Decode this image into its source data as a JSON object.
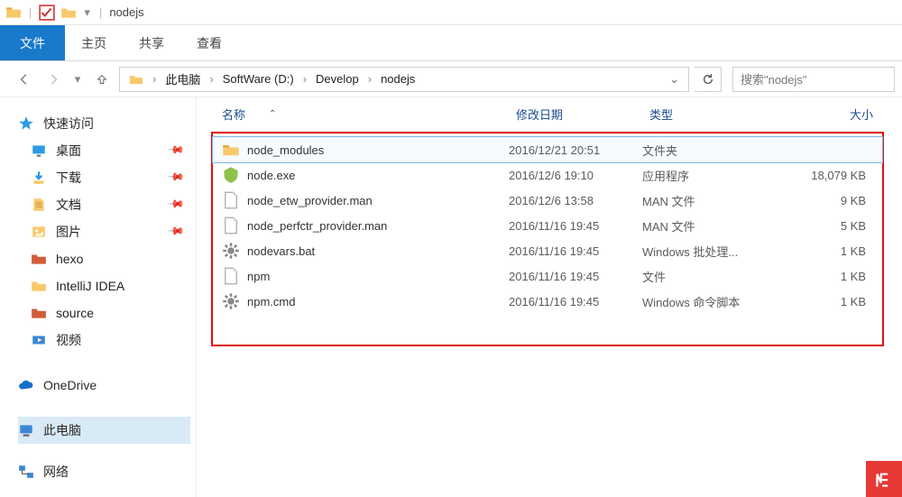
{
  "titlebar": {
    "appname": "nodejs"
  },
  "ribbon": {
    "file": "文件",
    "tabs": [
      "主页",
      "共享",
      "查看"
    ]
  },
  "breadcrumbs": [
    "此电脑",
    "SoftWare (D:)",
    "Develop",
    "nodejs"
  ],
  "search_placeholder": "搜索\"nodejs\"",
  "columns": {
    "name": "名称",
    "date": "修改日期",
    "type": "类型",
    "size": "大小"
  },
  "sidebar": {
    "quick_access": {
      "label": "快速访问",
      "items": [
        {
          "label": "桌面",
          "pinned": true,
          "icon": "desktop"
        },
        {
          "label": "下载",
          "pinned": true,
          "icon": "download"
        },
        {
          "label": "文档",
          "pinned": true,
          "icon": "document"
        },
        {
          "label": "图片",
          "pinned": true,
          "icon": "picture"
        },
        {
          "label": "hexo",
          "pinned": false,
          "icon": "folder-red"
        },
        {
          "label": "IntelliJ IDEA",
          "pinned": false,
          "icon": "folder-yellow"
        },
        {
          "label": "source",
          "pinned": false,
          "icon": "folder-red"
        },
        {
          "label": "视频",
          "pinned": false,
          "icon": "video"
        }
      ]
    },
    "onedrive": {
      "label": "OneDrive"
    },
    "thispc": {
      "label": "此电脑"
    },
    "network": {
      "label": "网络"
    }
  },
  "files": [
    {
      "icon": "folder",
      "name": "node_modules",
      "date": "2016/12/21 20:51",
      "type": "文件夹",
      "size": "",
      "selected": true
    },
    {
      "icon": "exe",
      "name": "node.exe",
      "date": "2016/12/6 19:10",
      "type": "应用程序",
      "size": "18,079 KB",
      "selected": false
    },
    {
      "icon": "file",
      "name": "node_etw_provider.man",
      "date": "2016/12/6 13:58",
      "type": "MAN 文件",
      "size": "9 KB",
      "selected": false
    },
    {
      "icon": "file",
      "name": "node_perfctr_provider.man",
      "date": "2016/11/16 19:45",
      "type": "MAN 文件",
      "size": "5 KB",
      "selected": false
    },
    {
      "icon": "gear",
      "name": "nodevars.bat",
      "date": "2016/11/16 19:45",
      "type": "Windows 批处理...",
      "size": "1 KB",
      "selected": false
    },
    {
      "icon": "file",
      "name": "npm",
      "date": "2016/11/16 19:45",
      "type": "文件",
      "size": "1 KB",
      "selected": false
    },
    {
      "icon": "gear",
      "name": "npm.cmd",
      "date": "2016/11/16 19:45",
      "type": "Windows 命令脚本",
      "size": "1 KB",
      "selected": false
    }
  ]
}
